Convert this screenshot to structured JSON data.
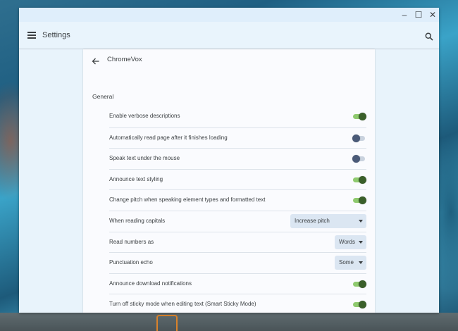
{
  "window": {
    "controls": {
      "minimize": "–",
      "maximize": "☐",
      "close": "✕"
    }
  },
  "appbar": {
    "title": "Settings",
    "menu_icon": "hamburger-menu-icon",
    "search_icon": "search-icon"
  },
  "subpage": {
    "back_icon": "back-arrow-icon",
    "title": "ChromeVox"
  },
  "section": {
    "title": "General"
  },
  "settings": [
    {
      "label": "Enable verbose descriptions",
      "type": "toggle",
      "on": true
    },
    {
      "label": "Automatically read page after it finishes loading",
      "type": "toggle",
      "on": false
    },
    {
      "label": "Speak text under the mouse",
      "type": "toggle",
      "on": false
    },
    {
      "label": "Announce text styling",
      "type": "toggle",
      "on": true
    },
    {
      "label": "Change pitch when speaking element types and formatted text",
      "type": "toggle",
      "on": true
    },
    {
      "label": "When reading capitals",
      "type": "select",
      "value": "Increase pitch"
    },
    {
      "label": "Read numbers as",
      "type": "select",
      "value": "Words"
    },
    {
      "label": "Punctuation echo",
      "type": "select",
      "value": "Some"
    },
    {
      "label": "Announce download notifications",
      "type": "toggle",
      "on": true
    },
    {
      "label": "Turn off sticky mode when editing text (Smart Sticky Mode)",
      "type": "toggle",
      "on": true
    }
  ],
  "colors": {
    "toggle_on_track": "#8fca6f",
    "toggle_on_knob": "#3a5f2a",
    "toggle_off_track": "#c9d2de",
    "toggle_off_knob": "#4a5a78",
    "window_background": "#e8f3fb",
    "card_background": "#fafbfe"
  }
}
